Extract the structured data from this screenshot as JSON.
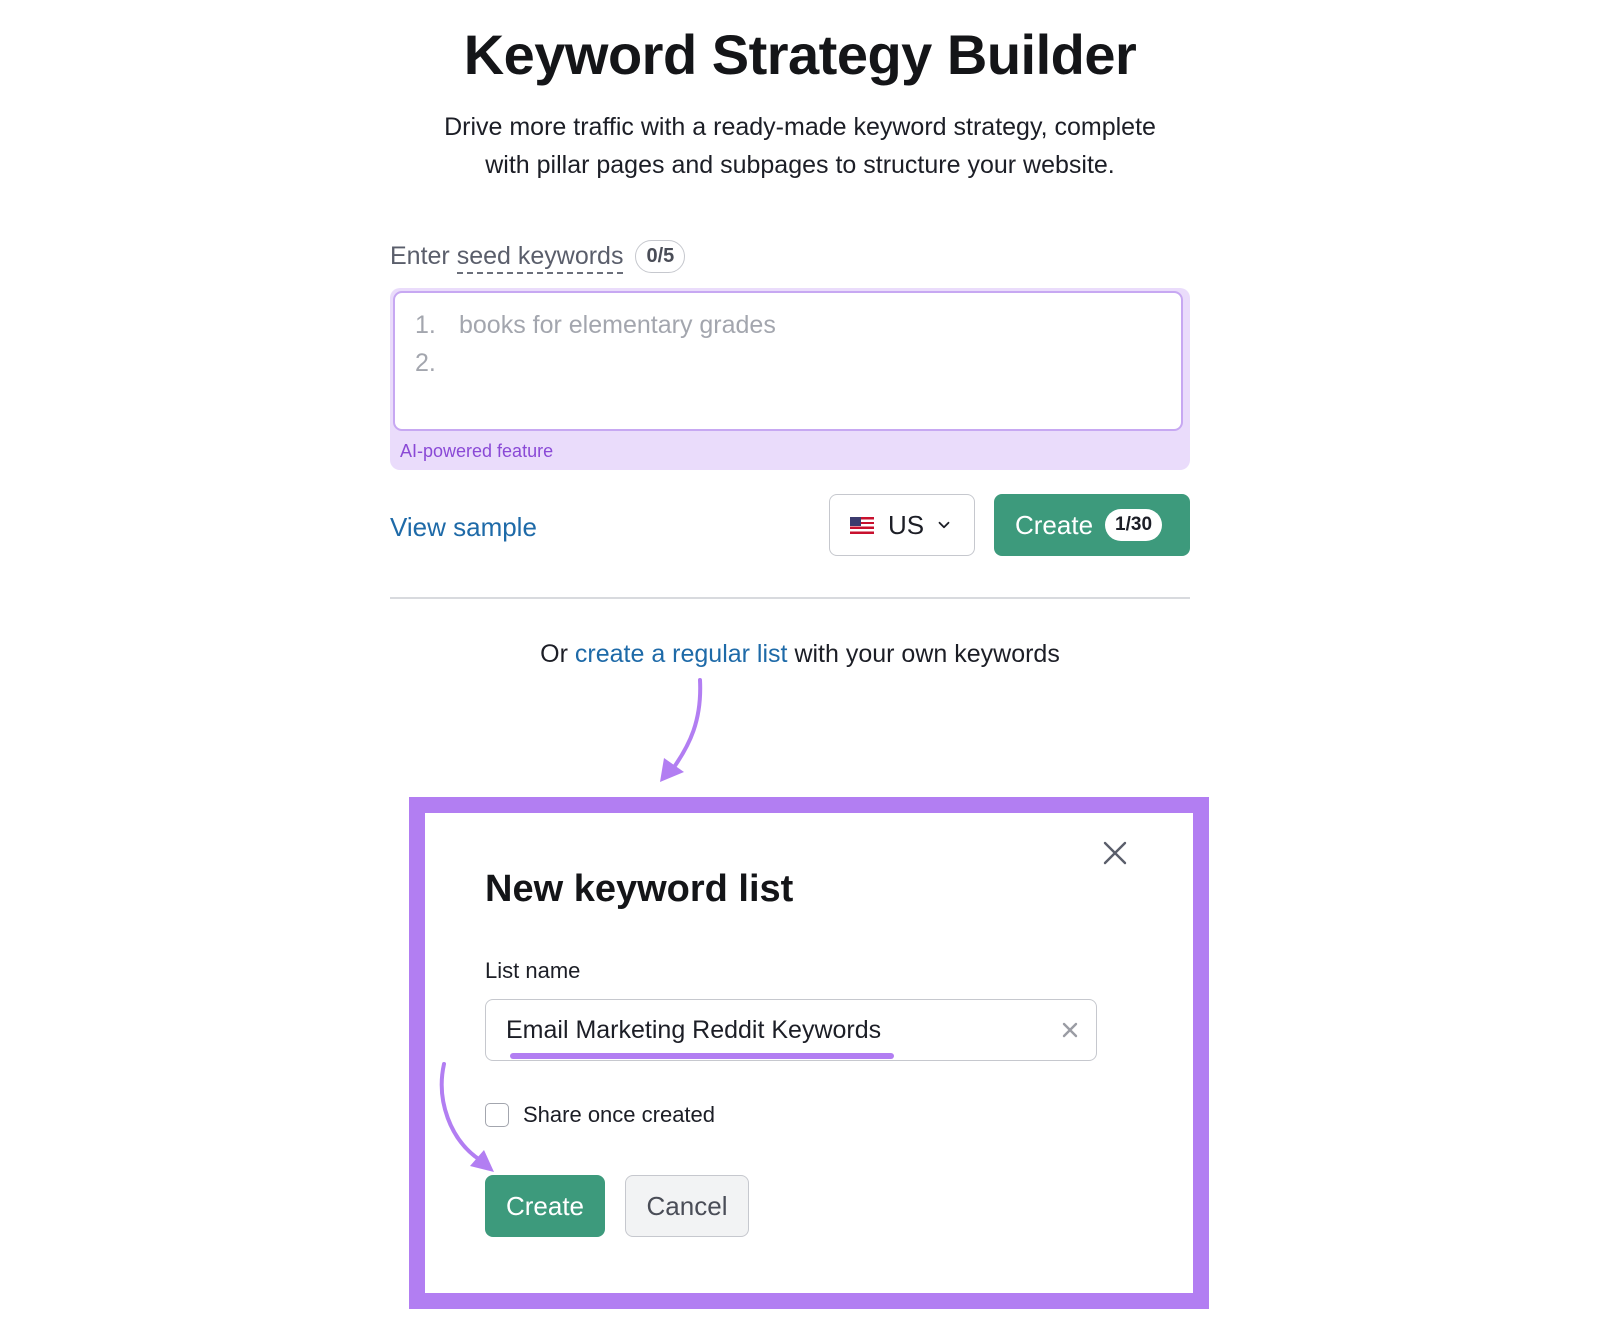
{
  "page": {
    "title": "Keyword Strategy Builder",
    "subtitle_line1": "Drive more traffic with a ready-made keyword strategy, complete",
    "subtitle_line2": "with pillar pages and subpages to structure your website."
  },
  "seed": {
    "label_prefix": "Enter ",
    "label_term": "seed keywords",
    "counter": "0/5",
    "lines": [
      {
        "num": "1.",
        "placeholder": "books for elementary grades"
      },
      {
        "num": "2.",
        "placeholder": ""
      }
    ],
    "ai_label": "AI-powered feature"
  },
  "actions": {
    "view_sample": "View sample",
    "country": "US",
    "create_label": "Create",
    "create_count": "1/30"
  },
  "alt": {
    "prefix": "Or ",
    "link": "create a regular list",
    "suffix": " with your own keywords"
  },
  "modal": {
    "title": "New keyword list",
    "list_name_label": "List name",
    "list_name_value": "Email Marketing Reddit Keywords",
    "share_label": "Share once created",
    "share_checked": false,
    "create_label": "Create",
    "cancel_label": "Cancel"
  },
  "icons": {
    "country_flag": "us-flag-icon",
    "dropdown": "chevron-down-icon",
    "close": "close-icon",
    "clear": "clear-icon"
  },
  "colors": {
    "primary_green": "#3d9a7c",
    "link_blue": "#1e6aa8",
    "highlight_purple": "#b27ef2",
    "ai_purple": "#8a49d6",
    "ai_bg": "#eadcfb"
  }
}
